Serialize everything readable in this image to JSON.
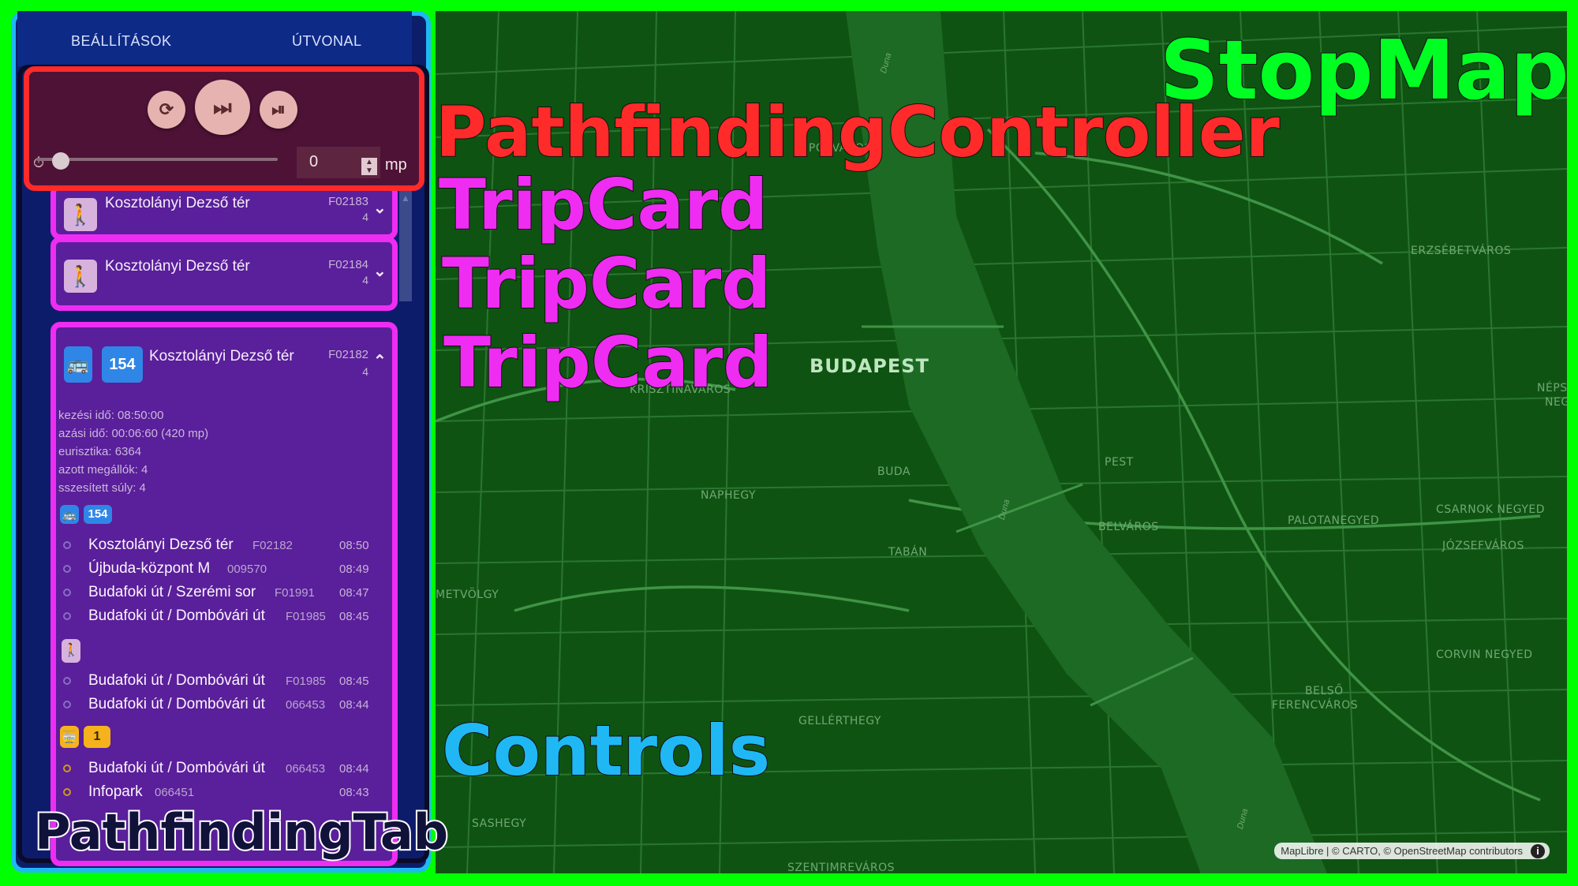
{
  "map": {
    "city_label": "BUDAPEST",
    "districts": {
      "lipotvaros": "LIPÓTVÁROS",
      "erzsebetvaros": "ERZSÉBETVÁROS",
      "krisztinavaros": "KRISZTINAVÁROS",
      "buda": "BUDA",
      "pest": "PEST",
      "naphegy": "NAPHEGY",
      "belvaros": "BELVÁROS",
      "taban": "TABÁN",
      "palotanegyed": "PALOTANEGYED",
      "csarnok": "CSARNOK NEGYED",
      "jozsefvaros": "JÓZSEFVÁROS",
      "nepszinhaz": "NÉPSZÍN",
      "nepszinhaz2": "NEGY",
      "corvin": "CORVIN NEGYED",
      "belso_ferencvaros_1": "BELSŐ",
      "belso_ferencvaros_2": "FERENCVÁROS",
      "gellerthegy": "GELLÉRTHEGY",
      "sashegy": "SASHEGY",
      "szentimrevaros": "SZENTIMREVÁROS",
      "metvolgy": "METVÖLGY"
    },
    "river_labels": [
      "Duna",
      "Duna",
      "Duna"
    ],
    "attribution": "MapLibre | © CARTO, © OpenStreetMap contributors",
    "attribution_info": "i"
  },
  "overlay_labels": {
    "stopmap": "StopMap",
    "controller": "PathfindingController",
    "tripcard1": "TripCard",
    "tripcard2": "TripCard",
    "tripcard3": "TripCard",
    "controls": "Controls",
    "pathfinding_tab": "PathfindingTab"
  },
  "tabs": {
    "settings": "BEÁLLÍTÁSOK",
    "route": "ÚTVONAL"
  },
  "controller": {
    "reset_icon": "⟳",
    "fast_forward_icon": "⏭",
    "step_icon": "⏯",
    "timer_icon": "⏱",
    "speed_value": "0",
    "speed_unit": "mp",
    "slider_value": 0
  },
  "cards": [
    {
      "title": "Kosztolányi Dezső tér",
      "code": "F02183",
      "count": "4",
      "chevron": "⌄"
    },
    {
      "title": "Kosztolányi Dezső tér",
      "code": "F02184",
      "count": "4",
      "chevron": "⌄"
    }
  ],
  "expanded_card": {
    "route": "154",
    "title": "Kosztolányi Dezső tér",
    "code": "F02182",
    "count": "4",
    "chevron": "⌃",
    "details": [
      "kezési idő: 08:50:00",
      "azási idő: 00:06:60 (420 mp)",
      "eurisztika: 6364",
      "azott megállók: 4",
      "sszesített súly: 4"
    ],
    "leg1_route": "154",
    "leg1_stops": [
      {
        "name": "Kosztolányi Dezső tér",
        "code": "F02182",
        "time": "08:50"
      },
      {
        "name": "Újbuda-központ M",
        "code": "009570",
        "time": "08:49"
      },
      {
        "name": "Budafoki út / Szerémi sor",
        "code": "F01991",
        "time": "08:47"
      },
      {
        "name": "Budafoki út / Dombóvári út",
        "code": "F01985",
        "time": "08:45"
      }
    ],
    "leg2_stops": [
      {
        "name": "Budafoki út / Dombóvári út",
        "code": "F01985",
        "time": "08:45"
      },
      {
        "name": "Budafoki út / Dombóvári út",
        "code": "066453",
        "time": "08:44"
      }
    ],
    "leg3_route": "1",
    "leg3_stops": [
      {
        "name": "Budafoki út / Dombóvári út",
        "code": "066453",
        "time": "08:44"
      },
      {
        "name": "Infopark",
        "code": "066451",
        "time": "08:43"
      }
    ]
  },
  "colors": {
    "stopmap": "#00ff00",
    "controller": "#ff2a2a",
    "tripcard": "#ef2cf2",
    "controls": "#1fb8f5",
    "pathfinding_tab": "#0a0a2a"
  }
}
